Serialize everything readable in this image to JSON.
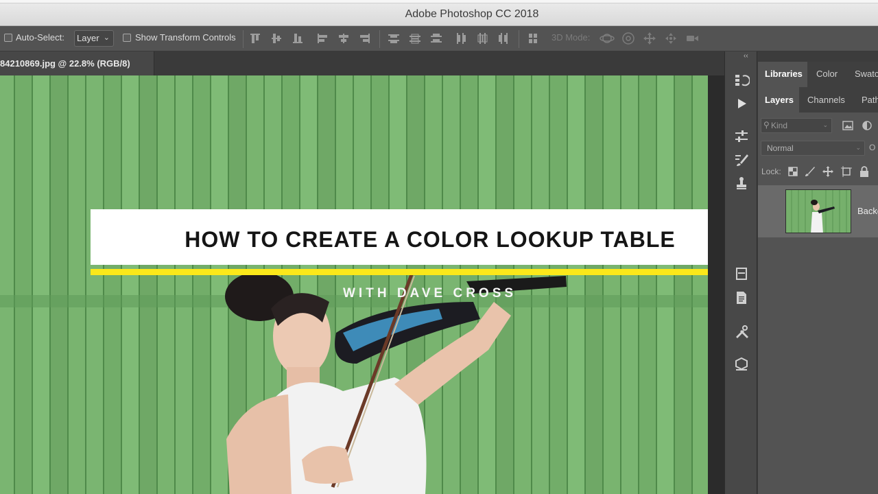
{
  "app": {
    "title": "Adobe Photoshop CC 2018"
  },
  "options_bar": {
    "auto_select_label": "Auto-Select:",
    "auto_select_value": "Layer",
    "show_transform_label": "Show Transform Controls",
    "mode_3d_label": "3D Mode:"
  },
  "document": {
    "tab_label": "84210869.jpg @ 22.8% (RGB/8)"
  },
  "overlay": {
    "title": "HOW TO CREATE A COLOR LOOKUP TABLE",
    "subtitle": "WITH DAVE CROSS"
  },
  "panels": {
    "top_tabs": [
      "Libraries",
      "Color",
      "Swatc"
    ],
    "layer_tabs": [
      "Layers",
      "Channels",
      "Path"
    ],
    "filter_kind": "Kind",
    "blend_mode": "Normal",
    "opacity_label": "O",
    "lock_label": "Lock:",
    "layer_name": "Backg"
  },
  "colors": {
    "accent_yellow": "#fbe81a",
    "wall_green": "#79b36f",
    "ui_dark": "#535353"
  },
  "icons": {
    "options": [
      "align-top-icon",
      "align-vertical-center-icon",
      "align-bottom-icon",
      "align-left-icon",
      "align-horizontal-center-icon",
      "align-right-icon",
      "distribute-top-icon",
      "distribute-vcenter-icon",
      "distribute-bottom-icon",
      "distribute-left-icon",
      "distribute-hcenter-icon",
      "distribute-right-icon",
      "auto-align-icon",
      "orbit-3d-icon",
      "roll-3d-icon",
      "pan-3d-icon",
      "slide-3d-icon",
      "scale-3d-icon"
    ],
    "column": [
      "history-icon",
      "actions-play-icon",
      "adjustments-icon",
      "brush-settings-icon",
      "clone-source-icon",
      "properties-icon",
      "notes-icon",
      "tool-presets-icon",
      "3d-icon"
    ]
  }
}
